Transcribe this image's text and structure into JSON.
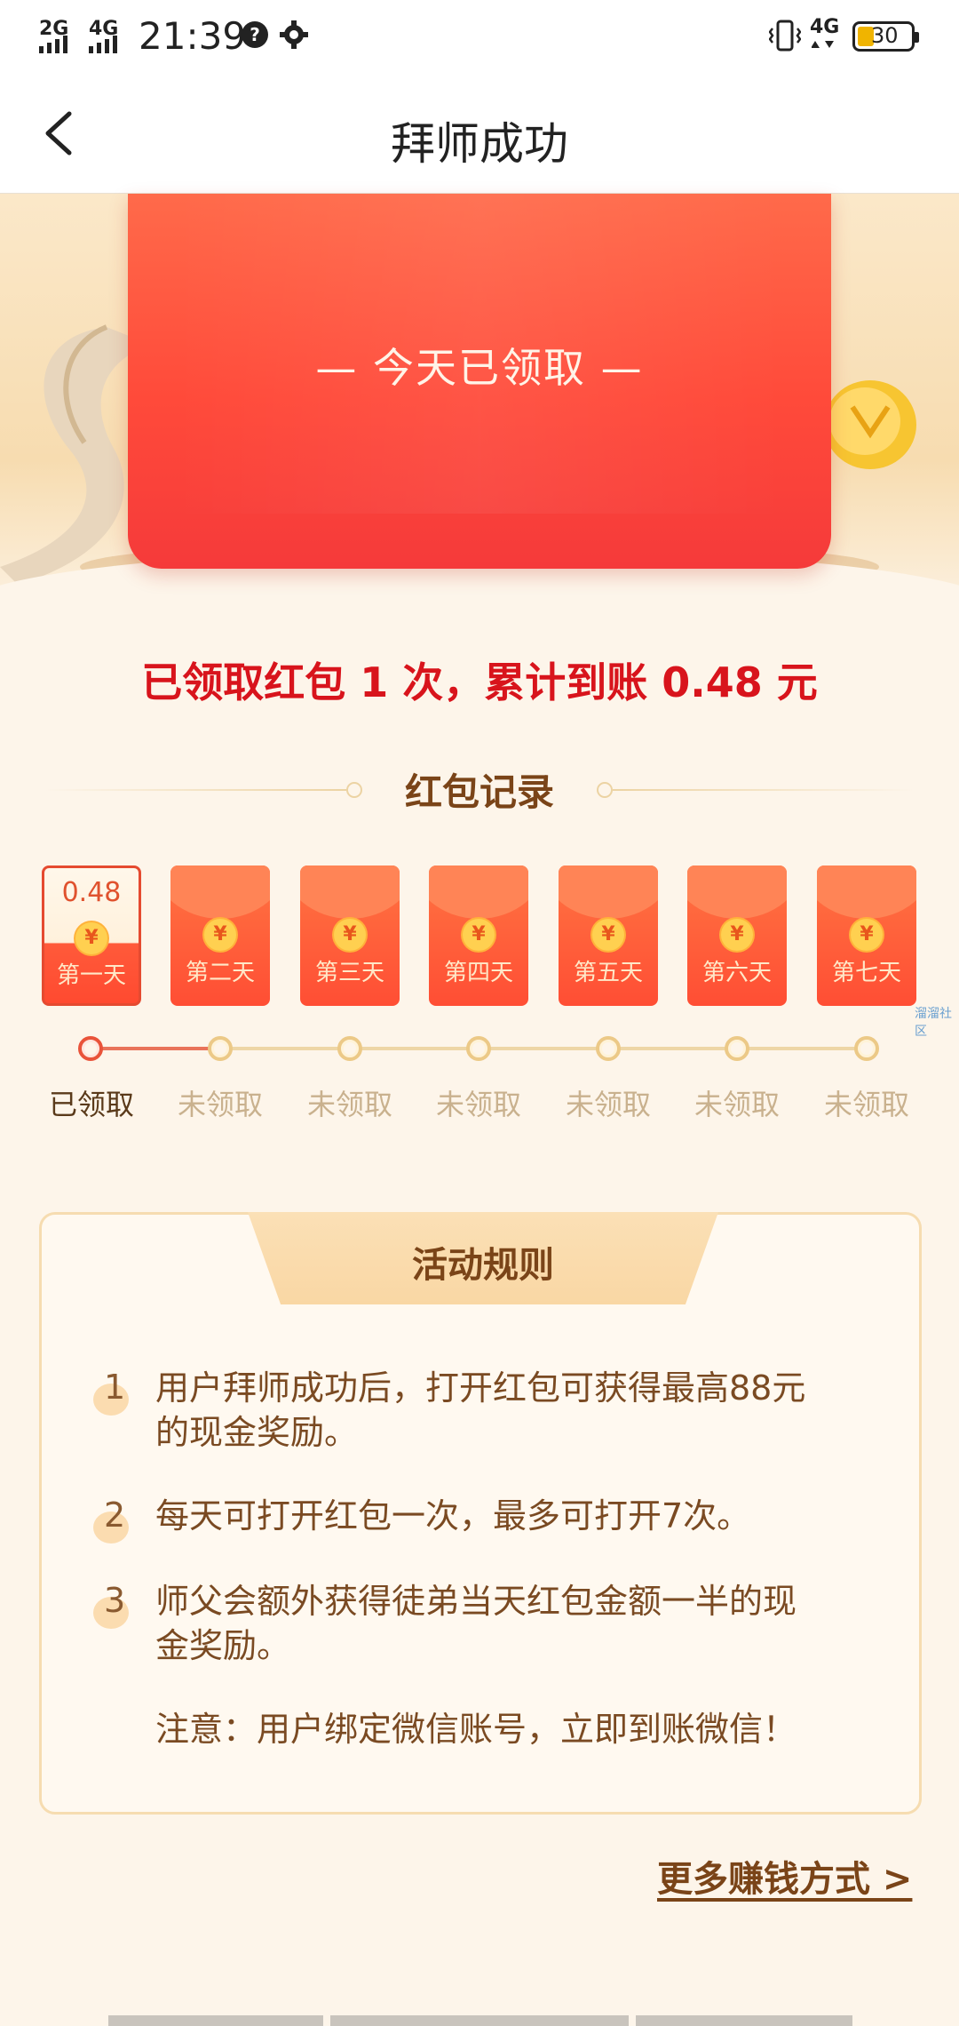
{
  "status_bar": {
    "signal_1": "2G",
    "signal_2": "4G",
    "time": "21:39",
    "network": "4G",
    "battery": "30"
  },
  "header": {
    "title": "拜师成功"
  },
  "hero": {
    "envelope_text": "— 今天已领取 —"
  },
  "summary": "已领取红包 1 次，累计到账 0.48 元",
  "records": {
    "title": "红包记录",
    "days": [
      {
        "label": "第一天",
        "amount": "0.48",
        "status": "已领取",
        "claimed": true
      },
      {
        "label": "第二天",
        "amount": "",
        "status": "未领取",
        "claimed": false
      },
      {
        "label": "第三天",
        "amount": "",
        "status": "未领取",
        "claimed": false
      },
      {
        "label": "第四天",
        "amount": "",
        "status": "未领取",
        "claimed": false
      },
      {
        "label": "第五天",
        "amount": "",
        "status": "未领取",
        "claimed": false
      },
      {
        "label": "第六天",
        "amount": "",
        "status": "未领取",
        "claimed": false
      },
      {
        "label": "第七天",
        "amount": "",
        "status": "未领取",
        "claimed": false
      }
    ],
    "yen_symbol": "¥",
    "watermark": "溜溜社区"
  },
  "rules": {
    "title": "活动规则",
    "items": [
      {
        "num": "1",
        "line1": "用户拜师成功后，打开红包可获得最高88元",
        "line2": "的现金奖励。"
      },
      {
        "num": "2",
        "line1": "每天可打开红包一次，最多可打开7次。",
        "line2": ""
      },
      {
        "num": "3",
        "line1": "师父会额外获得徒弟当天红包金额一半的现",
        "line2": "金奖励。"
      }
    ],
    "note": "注意：用户绑定微信账号，立即到账微信！"
  },
  "more_link": "更多赚钱方式 >",
  "colors": {
    "accent_red": "#d8141c",
    "brown": "#7a4418",
    "background": "#fdf5ea"
  }
}
